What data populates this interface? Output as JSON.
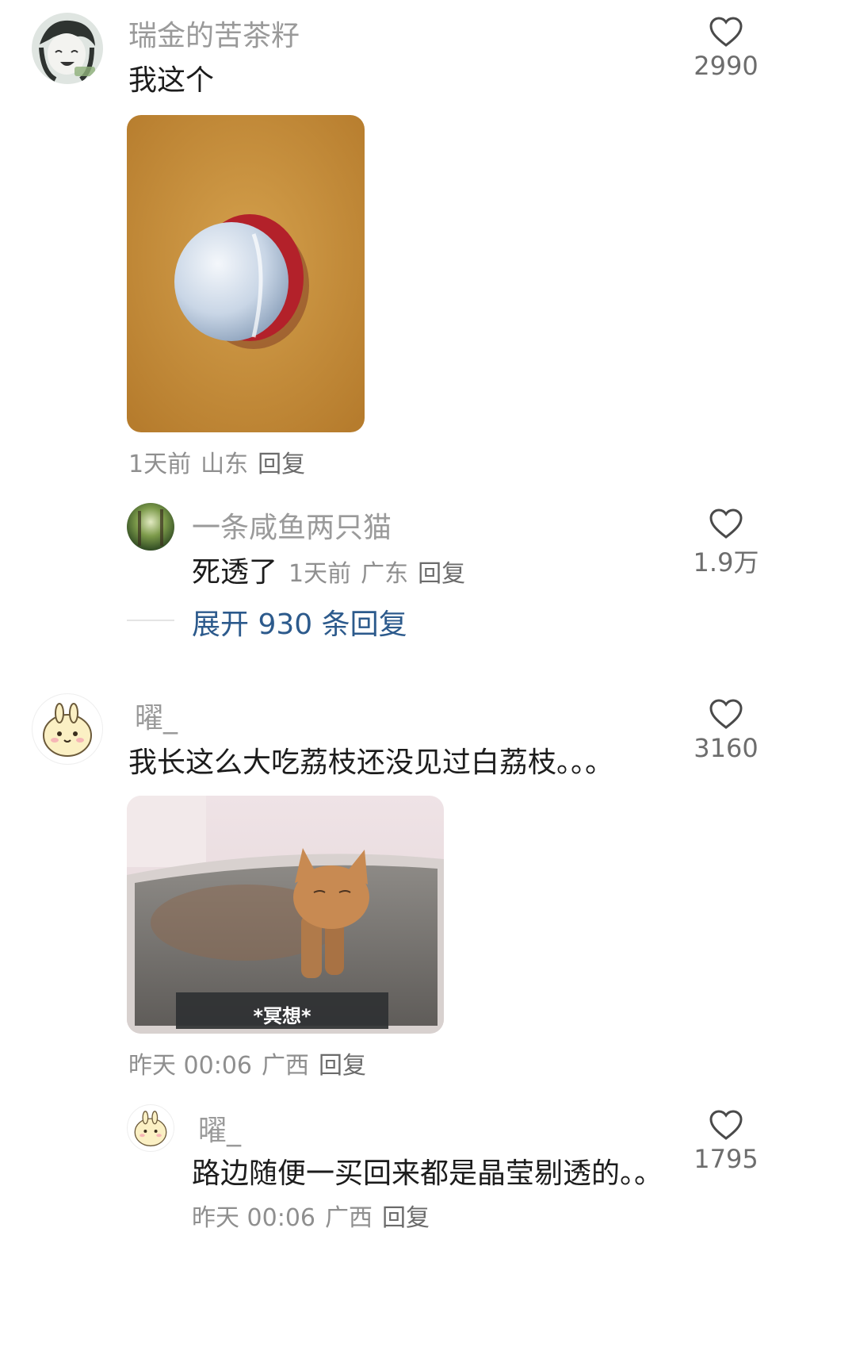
{
  "comments": [
    {
      "username": "瑞金的苦茶籽",
      "text": "我这个",
      "likes": "2990",
      "time": "1天前",
      "location": "山东",
      "reply_label": "回复",
      "reply": {
        "username": "一条咸鱼两只猫",
        "text": "死透了",
        "time": "1天前",
        "location": "广东",
        "reply_label": "回复",
        "likes": "1.9万"
      },
      "expand_label": "展开 930 条回复"
    },
    {
      "username": "曜_",
      "text": "我长这么大吃荔枝还没见过白荔枝。。。",
      "likes": "3160",
      "image_caption": "*冥想*",
      "time": "昨天 00:06",
      "location": "广西",
      "reply_label": "回复",
      "reply": {
        "username": "曜_",
        "text": "路边随便一买回来都是晶莹剔透的。。",
        "time": "昨天 00:06",
        "location": "广西",
        "reply_label": "回复",
        "likes": "1795"
      }
    }
  ],
  "icons": {
    "like": "heart-outline-icon"
  },
  "colors": {
    "link": "#2c5a8c",
    "muted": "#9a9a9a",
    "text": "#1c1c1c",
    "lychee_shell": "#b3212a",
    "photo_bg": "#c8923e"
  }
}
